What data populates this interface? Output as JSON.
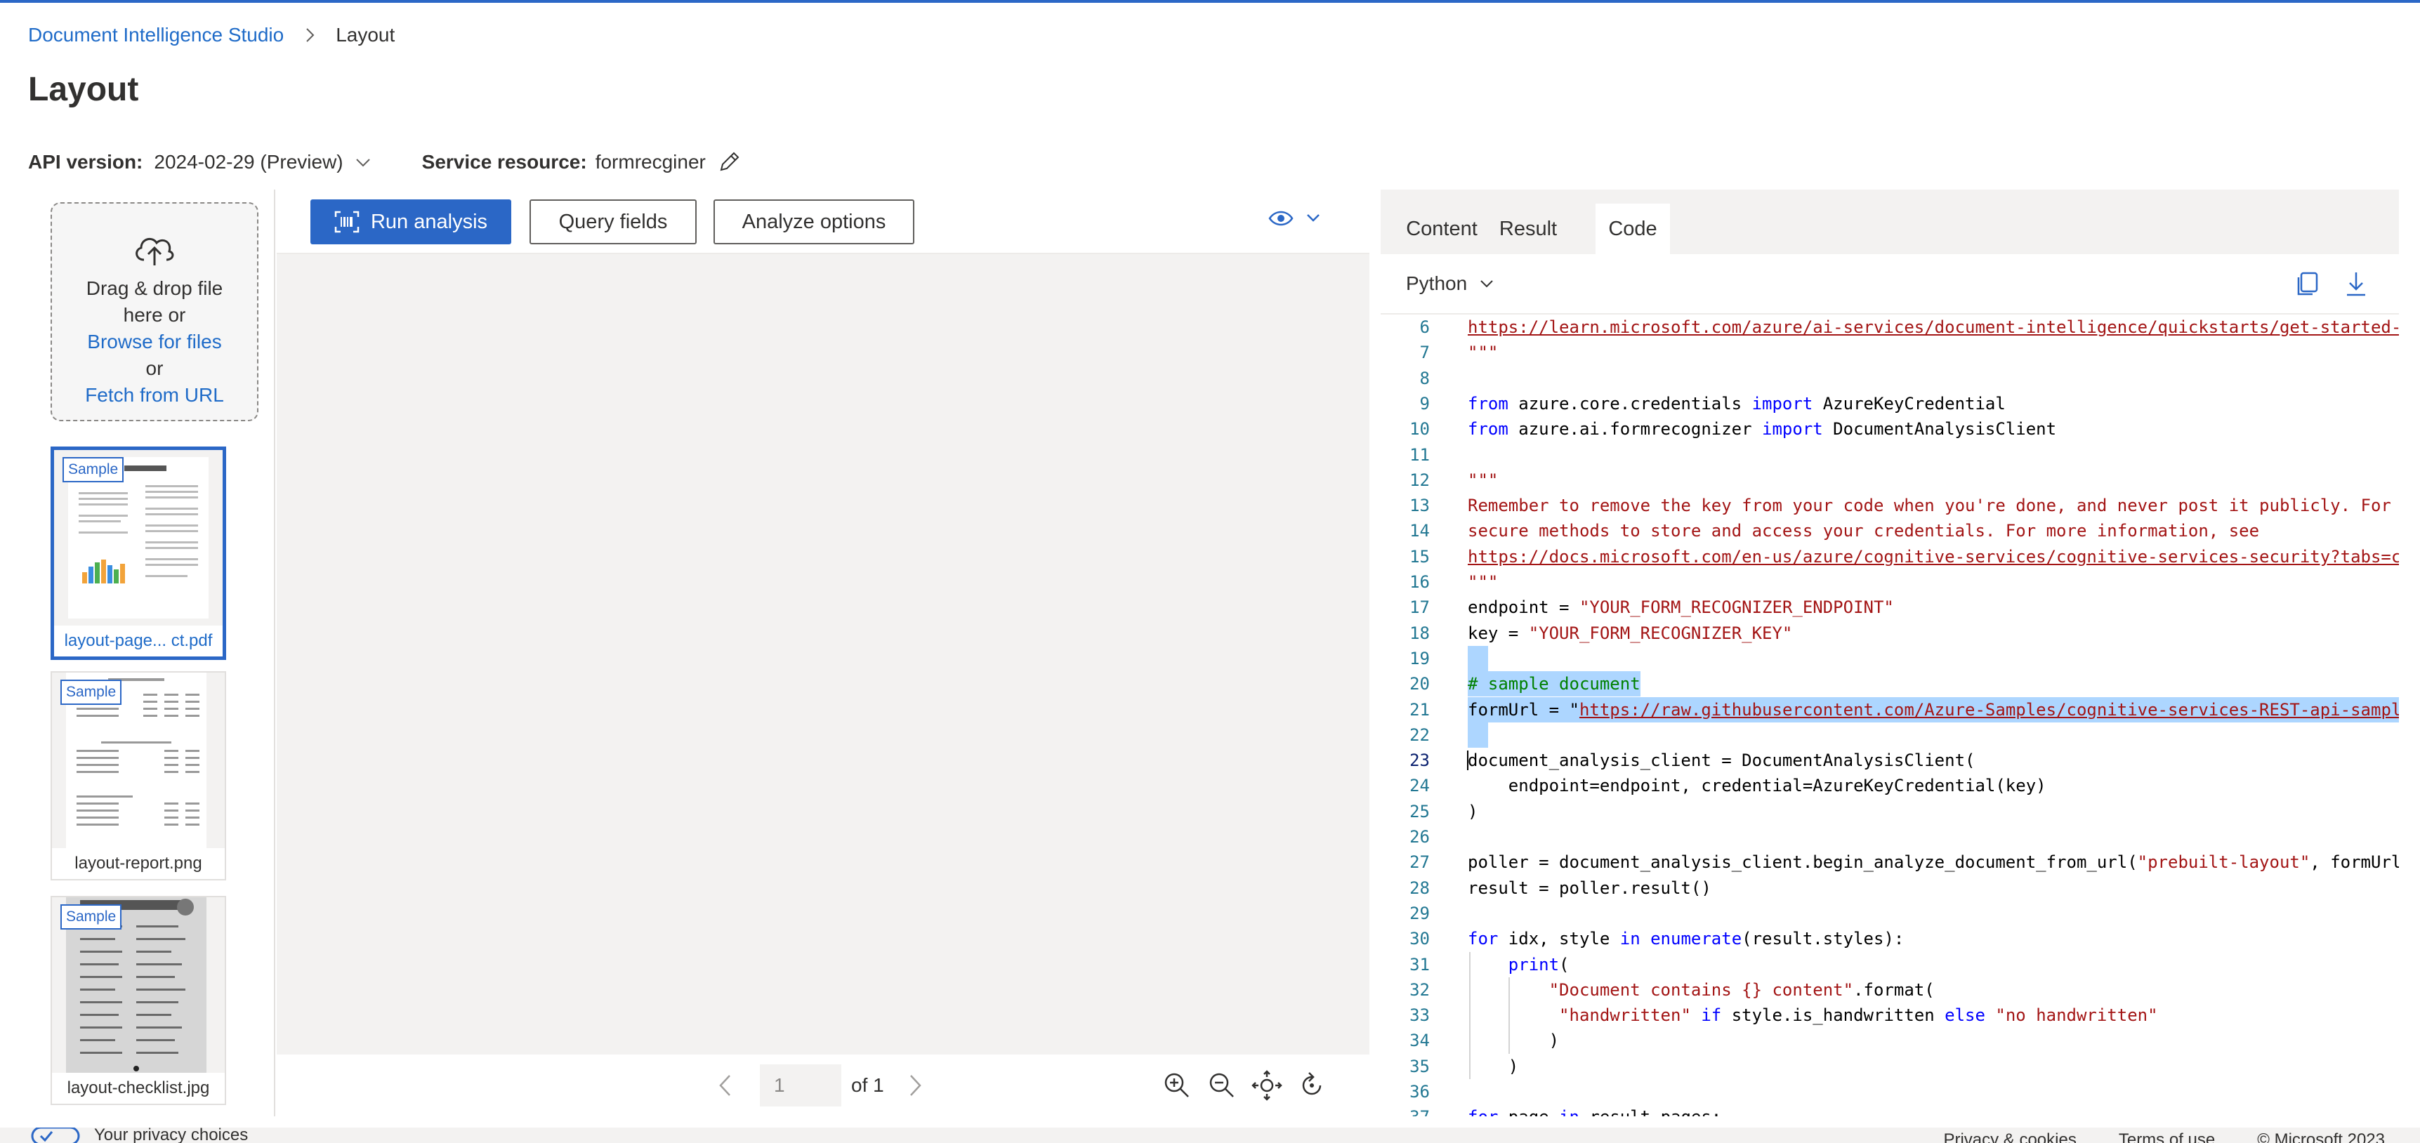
{
  "breadcrumb": {
    "root": "Document Intelligence Studio",
    "current": "Layout"
  },
  "page_title": "Layout",
  "api": {
    "label": "API version:",
    "value": "2024-02-29 (Preview)"
  },
  "service": {
    "label": "Service resource:",
    "value": "formrecginer"
  },
  "dropzone": {
    "line1": "Drag & drop file",
    "line2": "here or",
    "browse": "Browse for files",
    "or": "or",
    "fetch": "Fetch from URL"
  },
  "samples": [
    {
      "badge": "Sample",
      "name": "layout-page... ct.pdf",
      "selected": true
    },
    {
      "badge": "Sample",
      "name": "layout-report.png",
      "selected": false
    },
    {
      "badge": "Sample",
      "name": "layout-checklist.jpg",
      "selected": false
    }
  ],
  "toolbar": {
    "run": "Run analysis",
    "query": "Query fields",
    "analyze": "Analyze options"
  },
  "pager": {
    "page_input": "1",
    "of": "of 1"
  },
  "tabs": {
    "content": "Content",
    "result": "Result",
    "code": "Code",
    "active": "Code"
  },
  "code": {
    "language": "Python",
    "lines": [
      {
        "n": "6",
        "t": "https://learn.microsoft.com/azure/ai-services/document-intelligence/quickstarts/get-started-sdks-rest-api",
        "k": "url"
      },
      {
        "n": "7",
        "t": "\"\"\"",
        "k": "str"
      },
      {
        "n": "8",
        "t": "",
        "k": "plain"
      },
      {
        "n": "9",
        "t": "from azure.core.credentials import AzureKeyCredential",
        "k": "import"
      },
      {
        "n": "10",
        "t": "from azure.ai.formrecognizer import DocumentAnalysisClient",
        "k": "import"
      },
      {
        "n": "11",
        "t": "",
        "k": "plain"
      },
      {
        "n": "12",
        "t": "\"\"\"",
        "k": "str"
      },
      {
        "n": "13",
        "t": "Remember to remove the key from your code when you're done, and never post it publicly. For production, use",
        "k": "str"
      },
      {
        "n": "14",
        "t": "secure methods to store and access your credentials. For more information, see",
        "k": "str"
      },
      {
        "n": "15",
        "t": "https://docs.microsoft.com/en-us/azure/cognitive-services/cognitive-services-security?tabs=command-line",
        "k": "url"
      },
      {
        "n": "16",
        "t": "\"\"\"",
        "k": "str"
      },
      {
        "n": "17",
        "t": "endpoint = \"YOUR_FORM_RECOGNIZER_ENDPOINT\"",
        "k": "assign"
      },
      {
        "n": "18",
        "t": "key = \"YOUR_FORM_RECOGNIZER_KEY\"",
        "k": "assign"
      },
      {
        "n": "19",
        "t": "",
        "k": "plain",
        "hl": true
      },
      {
        "n": "20",
        "t": "# sample document",
        "k": "cmt",
        "hl": true
      },
      {
        "n": "21",
        "t": "formUrl = \"https://raw.githubusercontent.com/Azure-Samples/cognitive-services-REST-api-samples/master/curl",
        "k": "assign",
        "hl": true
      },
      {
        "n": "22",
        "t": "",
        "k": "plain",
        "hl": true
      },
      {
        "n": "23",
        "t": "document_analysis_client = DocumentAnalysisClient(",
        "k": "plain",
        "active": true
      },
      {
        "n": "24",
        "t": "    endpoint=endpoint, credential=AzureKeyCredential(key)",
        "k": "plain"
      },
      {
        "n": "25",
        "t": ")",
        "k": "plain"
      },
      {
        "n": "26",
        "t": "",
        "k": "plain"
      },
      {
        "n": "27",
        "t": "poller = document_analysis_client.begin_analyze_document_from_url(\"prebuilt-layout\", formUrl)",
        "k": "assign"
      },
      {
        "n": "28",
        "t": "result = poller.result()",
        "k": "plain"
      },
      {
        "n": "29",
        "t": "",
        "k": "plain"
      },
      {
        "n": "30",
        "t": "for idx, style in enumerate(result.styles):",
        "k": "for"
      },
      {
        "n": "31",
        "t": "    print(",
        "k": "fn"
      },
      {
        "n": "32",
        "t": "        \"Document contains {} content\".format(",
        "k": "assign"
      },
      {
        "n": "33",
        "t": "         \"handwritten\" if style.is_handwritten else \"no handwritten\"",
        "k": "ifelse"
      },
      {
        "n": "34",
        "t": "        )",
        "k": "plain"
      },
      {
        "n": "35",
        "t": "    )",
        "k": "plain"
      },
      {
        "n": "36",
        "t": "",
        "k": "plain"
      },
      {
        "n": "37",
        "t": "for page in result.pages:",
        "k": "for"
      }
    ]
  },
  "footer": {
    "privacy_choices": "Your privacy choices",
    "privacy": "Privacy & cookies",
    "terms": "Terms of use",
    "copyright": "© Microsoft 2023"
  },
  "colors": {
    "accent": "#2b67c6",
    "link": "#1f6bc8",
    "string": "#a31515",
    "keyword": "#0000ff",
    "comment": "#008000",
    "selection": "#add6ff"
  }
}
